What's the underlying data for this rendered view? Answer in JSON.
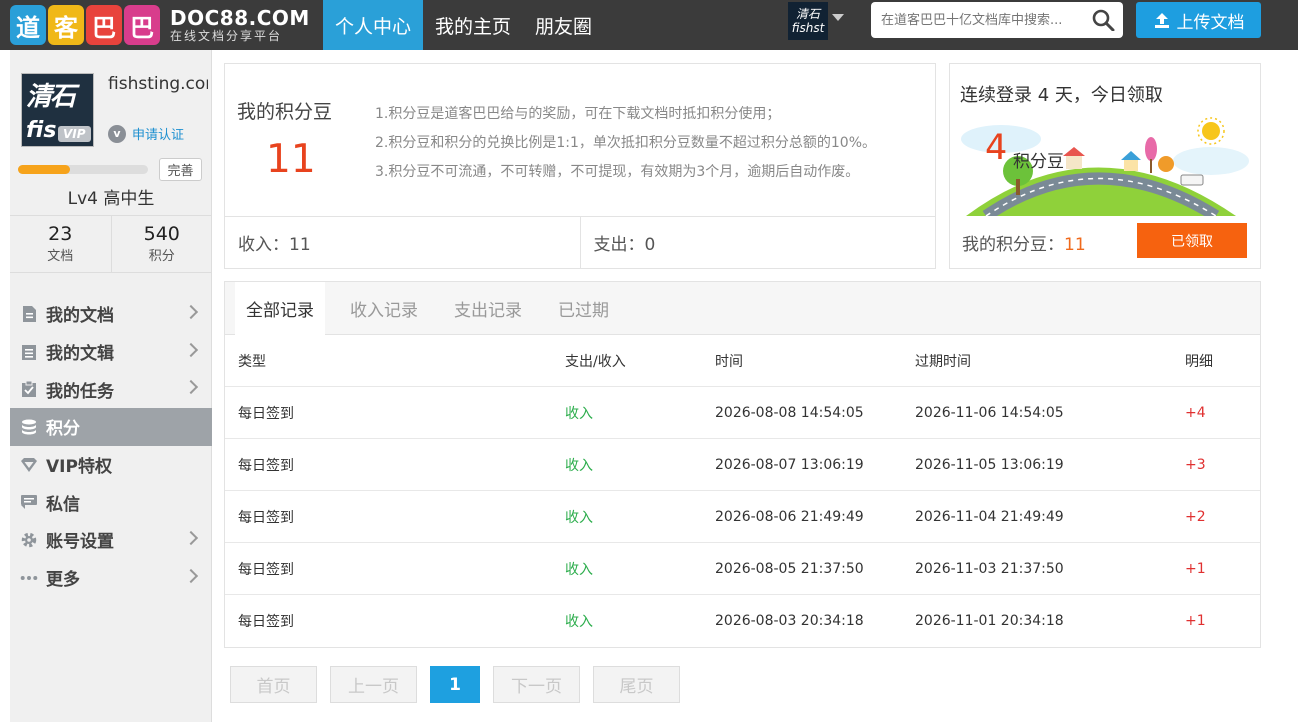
{
  "header": {
    "logo_chars": [
      "道",
      "客",
      "巴",
      "巴"
    ],
    "brand_name": "DOC88.COM",
    "brand_sub": "在线文档分享平台",
    "nav": [
      "个人中心",
      "我的主页",
      "朋友圈"
    ],
    "user_mini": {
      "line1": "清石",
      "line2": "fishst"
    },
    "search_placeholder": "在道客巴巴十亿文档库中搜索...",
    "upload_label": "上传文档"
  },
  "sidebar": {
    "avatar_text": {
      "top": "清石",
      "bottom": "fis"
    },
    "vip_label": "VIP",
    "username": "fishsting.com",
    "verify_label": "申请认证",
    "level_progress": 0.4,
    "complete_label": "完善",
    "level": "Lv4 高中生",
    "stats": [
      {
        "value": "23",
        "label": "文档"
      },
      {
        "value": "540",
        "label": "积分"
      }
    ],
    "menu": [
      {
        "label": "我的文档",
        "icon": "document-icon",
        "chevron": true,
        "active": false
      },
      {
        "label": "我的文辑",
        "icon": "collection-icon",
        "chevron": true,
        "active": false
      },
      {
        "label": "我的任务",
        "icon": "task-icon",
        "chevron": true,
        "active": false
      },
      {
        "label": "积分",
        "icon": "coins-icon",
        "chevron": false,
        "active": true
      },
      {
        "label": "VIP特权",
        "icon": "diamond-icon",
        "chevron": false,
        "active": false
      },
      {
        "label": "私信",
        "icon": "message-icon",
        "chevron": false,
        "active": false
      },
      {
        "label": "账号设置",
        "icon": "gear-icon",
        "chevron": true,
        "active": false
      },
      {
        "label": "更多",
        "icon": "more-icon",
        "chevron": true,
        "active": false
      }
    ]
  },
  "beans": {
    "title": "我的积分豆",
    "value": "11",
    "rules": [
      "1.积分豆是道客巴巴给与的奖励，可在下载文档时抵扣积分使用；",
      "2.积分豆和积分的兑换比例是1:1，单次抵扣积分豆数量不超过积分总额的10%。",
      "3.积分豆不可流通，不可转赠，不可提现，有效期为3个月，逾期后自动作废。"
    ],
    "income": "收入：11",
    "expense": "支出：0"
  },
  "signin": {
    "title": "连续登录 4 天，今日领取",
    "num": "4",
    "unit": "积分豆",
    "footer_label": "我的积分豆：",
    "footer_value": "11",
    "claimed_label": "已领取"
  },
  "records": {
    "tabs": [
      "全部记录",
      "收入记录",
      "支出记录",
      "已过期"
    ],
    "columns": [
      "类型",
      "支出/收入",
      "时间",
      "过期时间",
      "明细"
    ],
    "rows": [
      {
        "type": "每日签到",
        "direction": "收入",
        "time": "2026-08-08 14:54:05",
        "expire": "2026-11-06 14:54:05",
        "detail": "+4"
      },
      {
        "type": "每日签到",
        "direction": "收入",
        "time": "2026-08-07 13:06:19",
        "expire": "2026-11-05 13:06:19",
        "detail": "+3"
      },
      {
        "type": "每日签到",
        "direction": "收入",
        "time": "2026-08-06 21:49:49",
        "expire": "2026-11-04 21:49:49",
        "detail": "+2"
      },
      {
        "type": "每日签到",
        "direction": "收入",
        "time": "2026-08-05 21:37:50",
        "expire": "2026-11-03 21:37:50",
        "detail": "+1"
      },
      {
        "type": "每日签到",
        "direction": "收入",
        "time": "2026-08-03 20:34:18",
        "expire": "2026-11-01 20:34:18",
        "detail": "+1"
      }
    ]
  },
  "pager": {
    "first": "首页",
    "prev": "上一页",
    "current": "1",
    "next": "下一页",
    "last": "尾页"
  },
  "colors": {
    "accent": "#2aa0d8",
    "orange": "#f6620f",
    "income_green": "#2cad4c",
    "amount_red": "#e03030",
    "topbar": "#3b3b3b"
  }
}
